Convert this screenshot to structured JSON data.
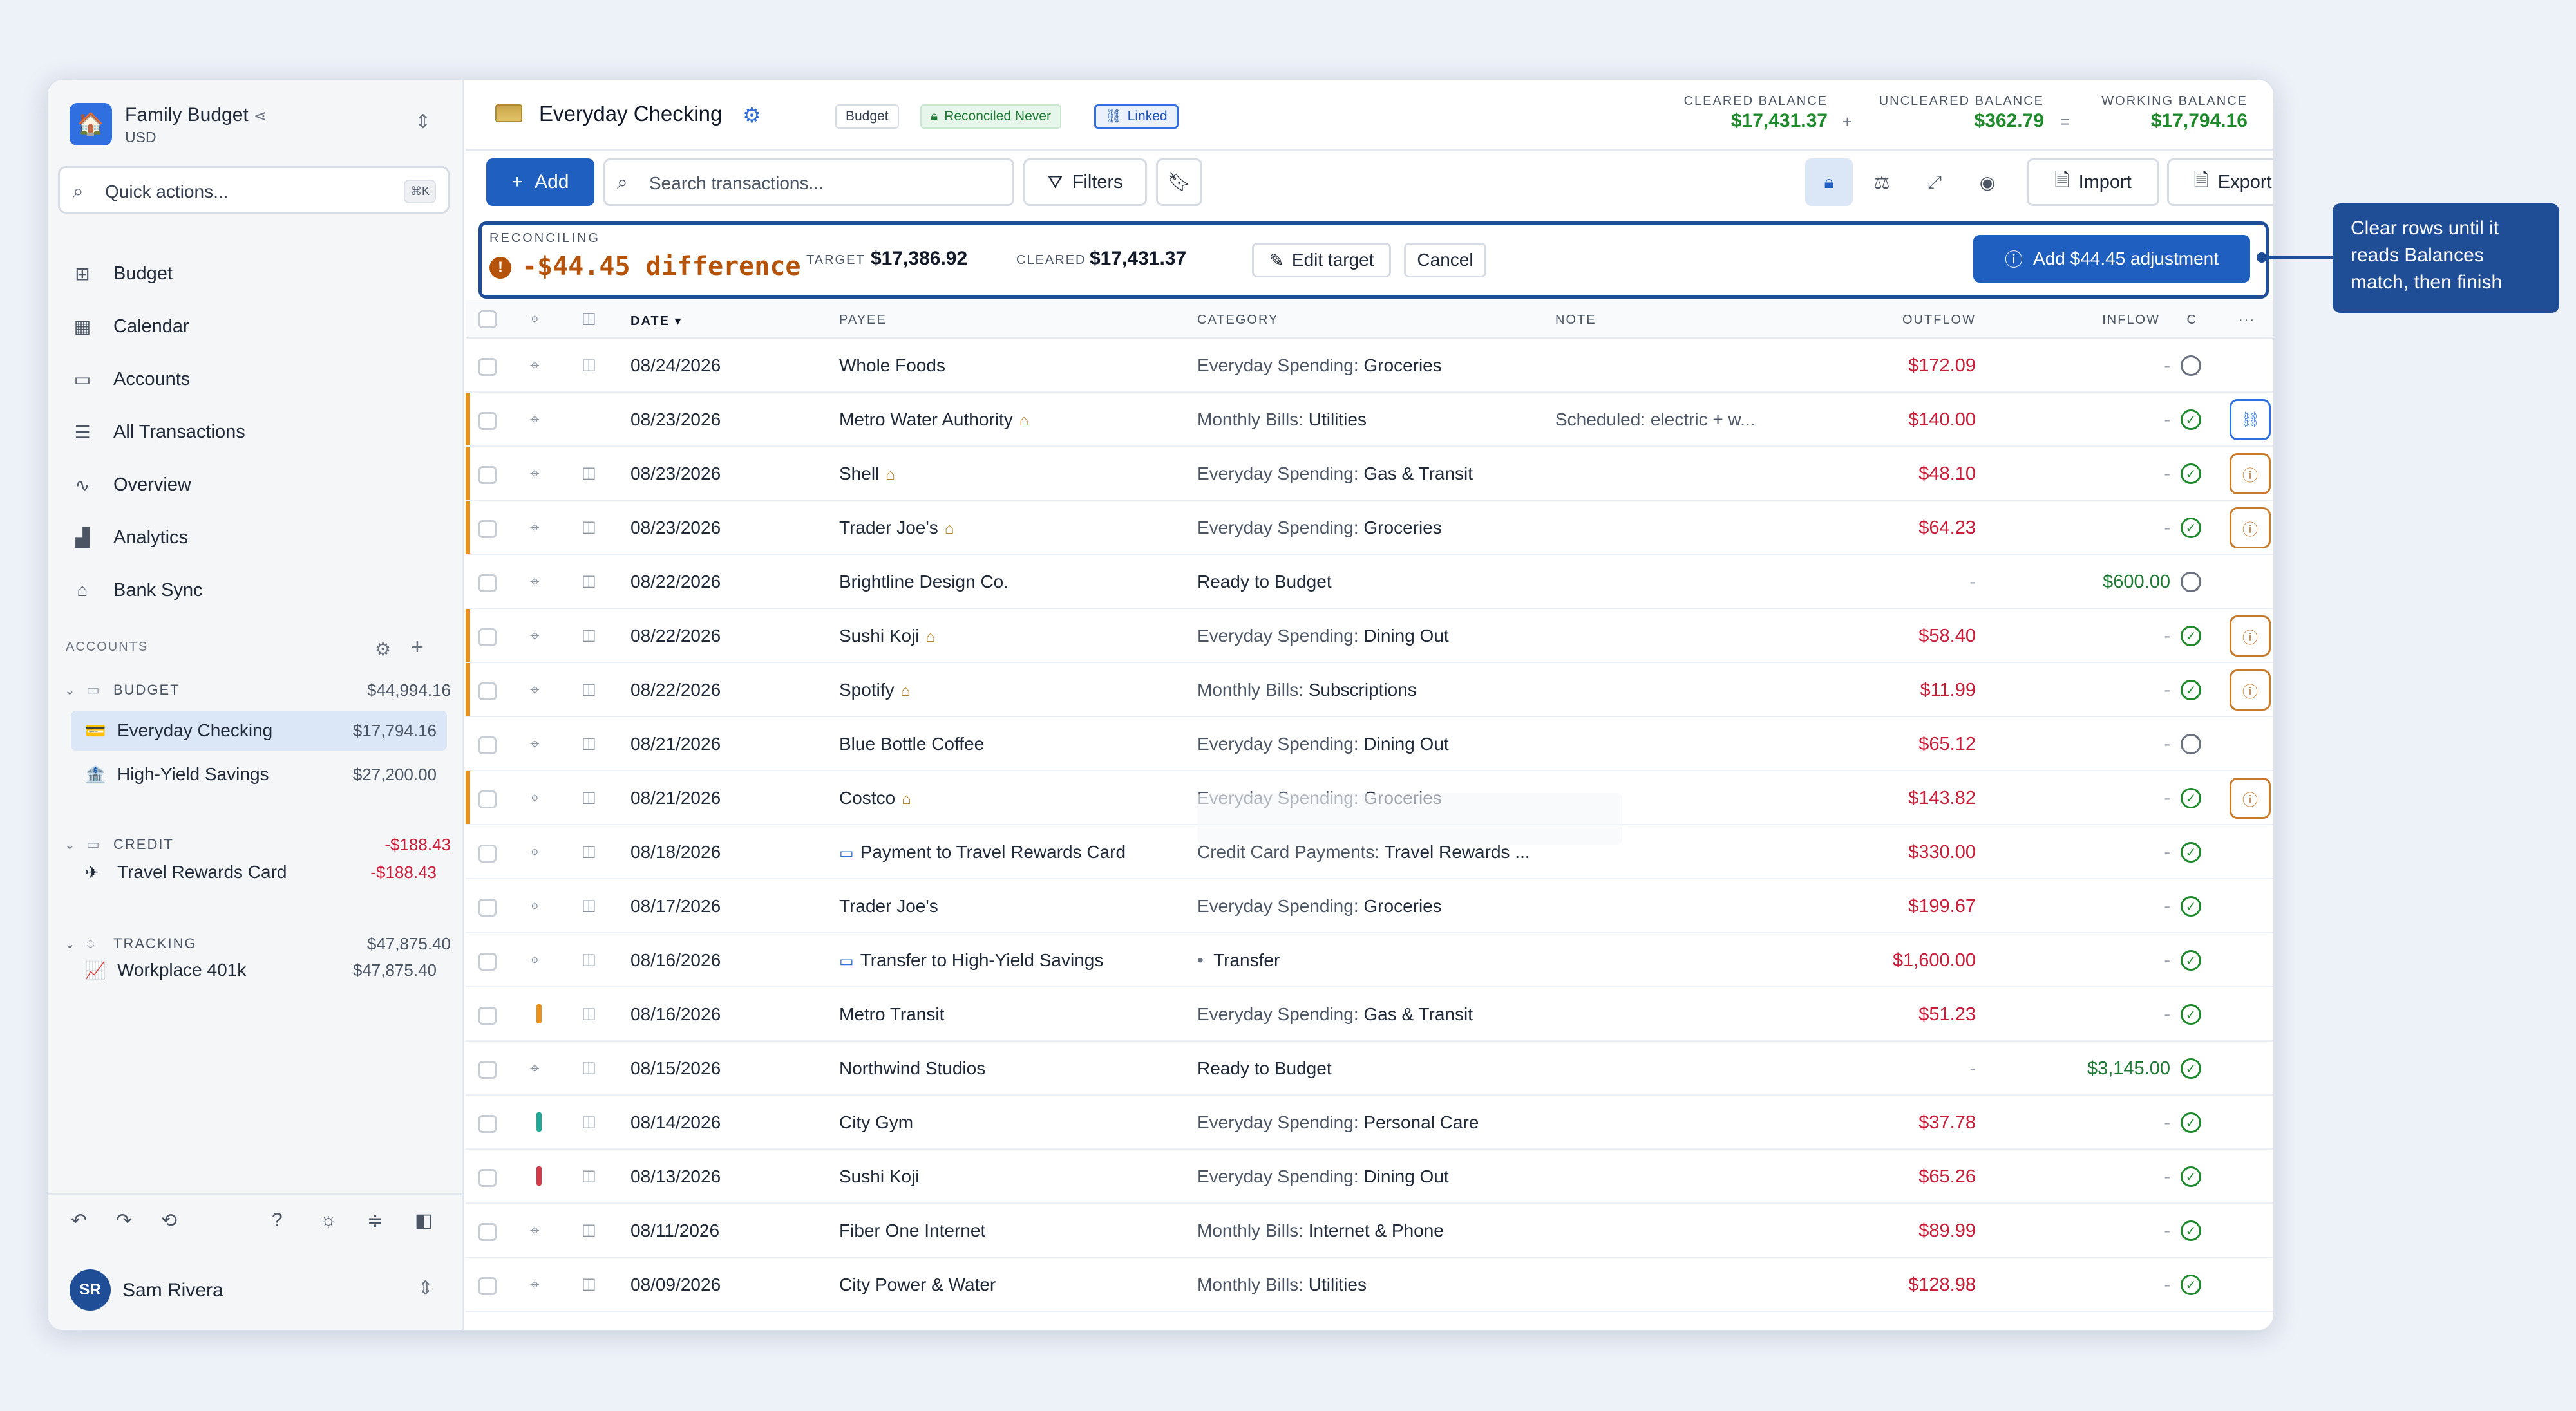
{
  "sidebar": {
    "workspace_name": "Family Budget",
    "workspace_currency": "USD",
    "quick_actions": {
      "label": "Quick actions...",
      "shortcut": "⌘K"
    },
    "nav": [
      {
        "label": "Budget",
        "icon": "grid-icon"
      },
      {
        "label": "Calendar",
        "icon": "calendar-icon"
      },
      {
        "label": "Accounts",
        "icon": "folder-icon"
      },
      {
        "label": "All Transactions",
        "icon": "list-icon"
      },
      {
        "label": "Overview",
        "icon": "pulse-icon"
      },
      {
        "label": "Analytics",
        "icon": "bar-chart-icon"
      },
      {
        "label": "Bank Sync",
        "icon": "bank-icon"
      }
    ],
    "accounts_label": "ACCOUNTS",
    "groups": [
      {
        "label": "BUDGET",
        "total": "$44,994.16",
        "accounts": [
          {
            "name": "Everyday Checking",
            "balance": "$17,794.16"
          },
          {
            "name": "High-Yield Savings",
            "balance": "$27,200.00"
          }
        ]
      },
      {
        "label": "CREDIT",
        "total": "-$188.43",
        "accounts": [
          {
            "name": "Travel Rewards Card",
            "balance": "-$188.43"
          }
        ]
      },
      {
        "label": "TRACKING",
        "total": "$47,875.40",
        "accounts": [
          {
            "name": "Workplace 401k",
            "balance": "$47,875.40"
          }
        ]
      }
    ],
    "user": {
      "initials": "SR",
      "name": "Sam Rivera"
    }
  },
  "header": {
    "account_title": "Everyday Checking",
    "badges": {
      "budget": "Budget",
      "reconciled": "Reconciled Never",
      "linked": "Linked"
    },
    "cleared": {
      "label": "CLEARED BALANCE",
      "value": "$17,431.37"
    },
    "uncleared": {
      "label": "UNCLEARED BALANCE",
      "value": "$362.79"
    },
    "working": {
      "label": "WORKING BALANCE",
      "value": "$17,794.16"
    },
    "plus": "+",
    "equals": "="
  },
  "toolbar": {
    "add_label": "Add",
    "search_placeholder": "Search transactions...",
    "filters_label": "Filters",
    "import_label": "Import",
    "export_label": "Export"
  },
  "reconcile": {
    "label": "RECONCILING",
    "difference": "-$44.45 difference",
    "target_label": "TARGET",
    "target_value": "$17,386.92",
    "cleared_label": "CLEARED",
    "cleared_value": "$17,431.37",
    "edit_target_label": "Edit target",
    "cancel_label": "Cancel",
    "adjust_label": "Add $44.45 adjustment"
  },
  "table": {
    "columns": {
      "date": "DATE",
      "payee": "PAYEE",
      "category": "CATEGORY",
      "note": "NOTE",
      "outflow": "OUTFLOW",
      "inflow": "INFLOW",
      "cleared": "C"
    },
    "rows": [
      {
        "date": "08/24/2026",
        "payee": "Whole Foods",
        "cat_group": "Everyday Spending:",
        "cat": "Groceries",
        "note": "",
        "outflow": "$172.09",
        "inflow": "-",
        "cleared": false
      },
      {
        "date": "08/23/2026",
        "payee": "Metro Water Authority",
        "cat_group": "Monthly Bills:",
        "cat": "Utilities",
        "note": "Scheduled: electric + w...",
        "outflow": "$140.00",
        "inflow": "-",
        "cleared": true
      },
      {
        "date": "08/23/2026",
        "payee": "Shell",
        "cat_group": "Everyday Spending:",
        "cat": "Gas & Transit",
        "note": "",
        "outflow": "$48.10",
        "inflow": "-",
        "cleared": true
      },
      {
        "date": "08/23/2026",
        "payee": "Trader Joe's",
        "cat_group": "Everyday Spending:",
        "cat": "Groceries",
        "note": "",
        "outflow": "$64.23",
        "inflow": "-",
        "cleared": true
      },
      {
        "date": "08/22/2026",
        "payee": "Brightline Design Co.",
        "cat_group": "",
        "cat": "Ready to Budget",
        "note": "",
        "outflow": "-",
        "inflow": "$600.00",
        "cleared": false
      },
      {
        "date": "08/22/2026",
        "payee": "Sushi Koji",
        "cat_group": "Everyday Spending:",
        "cat": "Dining Out",
        "note": "",
        "outflow": "$58.40",
        "inflow": "-",
        "cleared": true
      },
      {
        "date": "08/22/2026",
        "payee": "Spotify",
        "cat_group": "Monthly Bills:",
        "cat": "Subscriptions",
        "note": "",
        "outflow": "$11.99",
        "inflow": "-",
        "cleared": true
      },
      {
        "date": "08/21/2026",
        "payee": "Blue Bottle Coffee",
        "cat_group": "Everyday Spending:",
        "cat": "Dining Out",
        "note": "",
        "outflow": "$65.12",
        "inflow": "-",
        "cleared": false
      },
      {
        "date": "08/21/2026",
        "payee": "Costco",
        "cat_group": "Everyday Spending:",
        "cat": "Groceries",
        "note": "",
        "outflow": "$143.82",
        "inflow": "-",
        "cleared": true
      },
      {
        "date": "08/18/2026",
        "payee": "Payment to Travel Rewards Card",
        "cat_group": "Credit Card Payments:",
        "cat": "Travel Rewards ...",
        "note": "",
        "outflow": "$330.00",
        "inflow": "-",
        "cleared": true
      },
      {
        "date": "08/17/2026",
        "payee": "Trader Joe's",
        "cat_group": "Everyday Spending:",
        "cat": "Groceries",
        "note": "",
        "outflow": "$199.67",
        "inflow": "-",
        "cleared": true
      },
      {
        "date": "08/16/2026",
        "payee": "Transfer to High-Yield Savings",
        "cat_group": "",
        "cat": "Transfer",
        "note": "",
        "outflow": "$1,600.00",
        "inflow": "-",
        "cleared": true
      },
      {
        "date": "08/16/2026",
        "payee": "Metro Transit",
        "cat_group": "Everyday Spending:",
        "cat": "Gas & Transit",
        "note": "",
        "outflow": "$51.23",
        "inflow": "-",
        "cleared": true
      },
      {
        "date": "08/15/2026",
        "payee": "Northwind Studios",
        "cat_group": "",
        "cat": "Ready to Budget",
        "note": "",
        "outflow": "-",
        "inflow": "$3,145.00",
        "cleared": true
      },
      {
        "date": "08/14/2026",
        "payee": "City Gym",
        "cat_group": "Everyday Spending:",
        "cat": "Personal Care",
        "note": "",
        "outflow": "$37.78",
        "inflow": "-",
        "cleared": true
      },
      {
        "date": "08/13/2026",
        "payee": "Sushi Koji",
        "cat_group": "Everyday Spending:",
        "cat": "Dining Out",
        "note": "",
        "outflow": "$65.26",
        "inflow": "-",
        "cleared": true
      },
      {
        "date": "08/11/2026",
        "payee": "Fiber One Internet",
        "cat_group": "Monthly Bills:",
        "cat": "Internet & Phone",
        "note": "",
        "outflow": "$89.99",
        "inflow": "-",
        "cleared": true
      },
      {
        "date": "08/09/2026",
        "payee": "City Power & Water",
        "cat_group": "Monthly Bills:",
        "cat": "Utilities",
        "note": "",
        "outflow": "$128.98",
        "inflow": "-",
        "cleared": true
      }
    ]
  },
  "callout": {
    "text": "Clear rows until it reads Balances match, then finish"
  }
}
